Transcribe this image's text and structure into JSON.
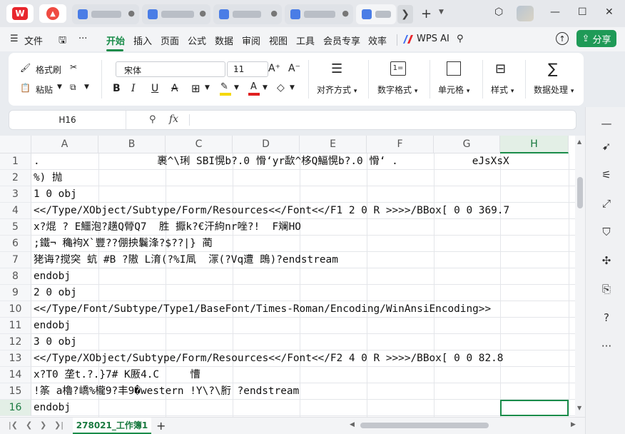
{
  "titlebar": {
    "tabs": [
      {
        "blur_width": 50
      },
      {
        "blur_width": 55
      },
      {
        "blur_width": 45
      },
      {
        "blur_width": 50
      },
      {
        "blur_width": 25
      }
    ],
    "more_label": "❯",
    "add_label": "+"
  },
  "menubar": {
    "file_label": "文件",
    "items": [
      "开始",
      "插入",
      "页面",
      "公式",
      "数据",
      "审阅",
      "视图",
      "工具",
      "会员专享",
      "效率"
    ],
    "active_item": "开始",
    "wps_ai_label": "WPS AI",
    "share_label": "分享"
  },
  "ribbon": {
    "format_painter": "格式刷",
    "paste": "粘贴",
    "font_name": "宋体",
    "font_size": "11",
    "bold": "B",
    "italic": "I",
    "underline": "U",
    "strike": "A",
    "align_label": "对齐方式",
    "number_format_label": "数字格式",
    "cell_label": "单元格",
    "style_label": "样式",
    "data_process_label": "数据处理",
    "font_color": "#e02020",
    "fill_color": "#f5d800"
  },
  "formula_bar": {
    "name_box": "H16",
    "fx_label": "fx",
    "content": ""
  },
  "sheet": {
    "columns": [
      "A",
      "B",
      "C",
      "D",
      "E",
      "F",
      "G",
      "H"
    ],
    "selected_column": "H",
    "selected_row": "16",
    "rows": [
      {
        "num": "1",
        "text": ".                   裹^\\琍 SBI愰b?.0 愲‘yr歃^栘Q鰏愰b?.0 愲‘ .            eJsXsX"
      },
      {
        "num": "2",
        "text": "%) 抛"
      },
      {
        "num": "3",
        "text": "1 0 obj"
      },
      {
        "num": "4",
        "text": "<</Type/XObject/Subtype/Form/Resources<</Font<</F1 2 0 R >>>>/BBox[ 0 0 369.7"
      },
      {
        "num": "5",
        "text": "x?焜 ? E鱷泡?趪Q膋Q7  胜 擫k?€汗絇nr唑?!  F斓HO"
      },
      {
        "num": "6",
        "text": ";鐵¬ 穐袧X`豐??倗抰鬤浲?$??|} 蔺"
      },
      {
        "num": "7",
        "text": "狫诲?搅突 蚢 #B ?隞 L淯(?%I凬  溕(?Vq遭 鵖)?endstream"
      },
      {
        "num": "8",
        "text": "endobj"
      },
      {
        "num": "9",
        "text": "2 0 obj"
      },
      {
        "num": "10",
        "text": "<</Type/Font/Subtype/Type1/BaseFont/Times-Roman/Encoding/WinAnsiEncoding>>"
      },
      {
        "num": "11",
        "text": "endobj"
      },
      {
        "num": "12",
        "text": "3 0 obj"
      },
      {
        "num": "13",
        "text": "<</Type/XObject/Subtype/Form/Resources<</Font<</F2 4 0 R >>>>/BBox[ 0 0 82.8"
      },
      {
        "num": "14",
        "text": "x?T0 垄t.?.}7# K厫4.C     慒"
      },
      {
        "num": "15",
        "text": "!筿 a櫓?嶠%櫳9?丰9�western !Y\\?\\胻 ?endstream"
      },
      {
        "num": "16",
        "text": "endobj"
      }
    ]
  },
  "sheetbar": {
    "sheet_name": "278021_工作簿1",
    "add_label": "+"
  },
  "colors": {
    "accent": "#1a8c4a",
    "share_bg": "#1f9a57",
    "wps_red": "#e8262d"
  }
}
